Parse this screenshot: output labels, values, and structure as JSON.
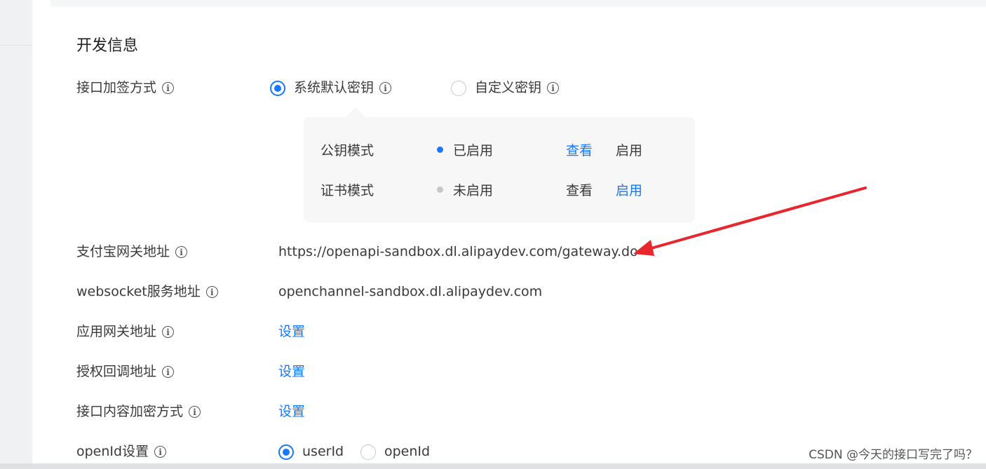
{
  "section_title": "开发信息",
  "sign_method": {
    "label": "接口加签方式",
    "options": [
      {
        "label": "系统默认密钥",
        "checked": true
      },
      {
        "label": "自定义密钥",
        "checked": false
      }
    ],
    "modes": [
      {
        "name": "公钥模式",
        "status": "已启用",
        "status_color": "#1677ff",
        "view": "查看",
        "enable": "启用"
      },
      {
        "name": "证书模式",
        "status": "未启用",
        "status_color": "#c7c7c7",
        "view": "查看",
        "enable": "启用"
      }
    ]
  },
  "gateway": {
    "label": "支付宝网关地址",
    "value": "https://openapi-sandbox.dl.alipaydev.com/gateway.do"
  },
  "websocket": {
    "label": "websocket服务地址",
    "value": "openchannel-sandbox.dl.alipaydev.com"
  },
  "app_gateway": {
    "label": "应用网关地址",
    "action": "设置"
  },
  "auth_callback": {
    "label": "授权回调地址",
    "action": "设置"
  },
  "content_encrypt": {
    "label": "接口内容加密方式",
    "action": "设置"
  },
  "openid": {
    "label": "openId设置",
    "options": [
      {
        "label": "userId",
        "checked": true
      },
      {
        "label": "openId",
        "checked": false
      }
    ]
  },
  "watermark": "CSDN @今天的接口写完了吗？",
  "colors": {
    "accent": "#1677ff",
    "arrow": "#e8262d"
  }
}
